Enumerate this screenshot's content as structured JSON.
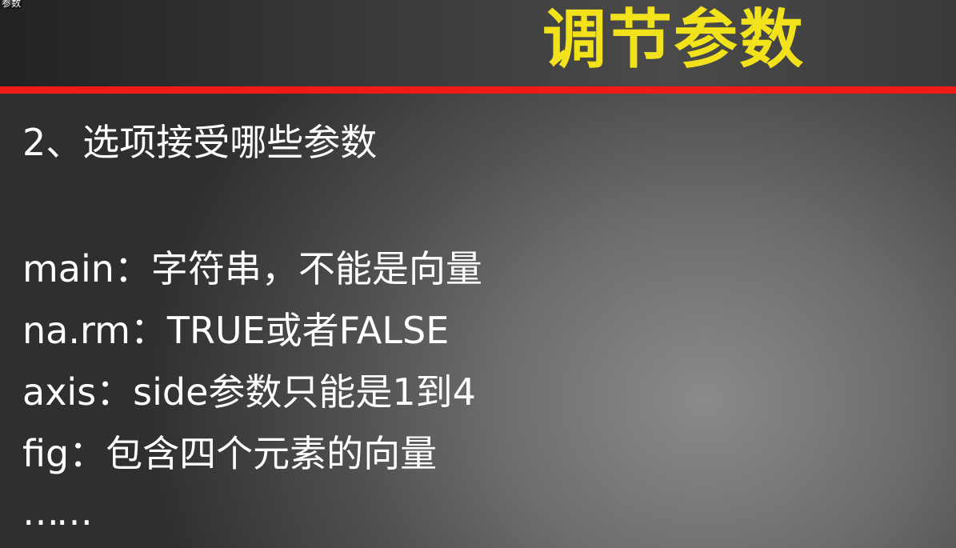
{
  "corner_label": "参数",
  "title": "调节参数",
  "heading": "2、选项接受哪些参数",
  "items": [
    "main：字符串，不能是向量",
    "na.rm：TRUE或者FALSE",
    "axis：side参数只能是1到4",
    "fig：包含四个元素的向量"
  ],
  "ellipsis": "……",
  "colors": {
    "title": "#f2e21b",
    "rule": "#ee1b16",
    "text": "#ffffff",
    "background": "#6f6f6f"
  }
}
